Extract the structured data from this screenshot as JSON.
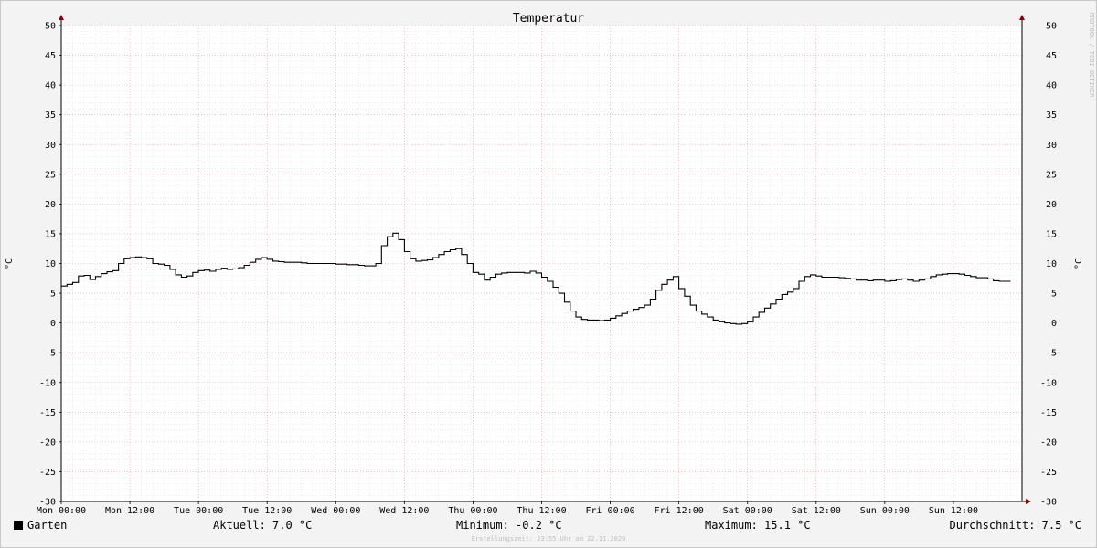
{
  "chart_data": {
    "type": "line",
    "title": "Temperatur",
    "ylabel_left": "°C",
    "ylabel_right": "°C",
    "ylim": [
      -30,
      50
    ],
    "y_ticks": [
      50,
      45,
      40,
      35,
      30,
      25,
      20,
      15,
      10,
      5,
      0,
      -5,
      -10,
      -15,
      -20,
      -25,
      -30
    ],
    "x_tick_labels": [
      "Mon 00:00",
      "Mon 12:00",
      "Tue 00:00",
      "Tue 12:00",
      "Wed 00:00",
      "Wed 12:00",
      "Thu 00:00",
      "Thu 12:00",
      "Fri 00:00",
      "Fri 12:00",
      "Sat 00:00",
      "Sat 12:00",
      "Sun 00:00",
      "Sun 12:00"
    ],
    "xlim_hours": [
      0,
      168
    ],
    "grid": true,
    "colors": {
      "background": "#f3f3f3",
      "plot": "#ffffff",
      "line": "#000000",
      "major_grid": "#e6a0a0",
      "minor_grid": "#dcdcdc",
      "arrow": "#8b0000"
    },
    "series": [
      {
        "name": "Garten",
        "x_hours": [
          0,
          1,
          2,
          3,
          4,
          5,
          6,
          7,
          8,
          9,
          10,
          11,
          12,
          13,
          14,
          15,
          16,
          17,
          18,
          19,
          20,
          21,
          22,
          23,
          24,
          25,
          26,
          27,
          28,
          29,
          30,
          31,
          32,
          33,
          34,
          35,
          36,
          37,
          38,
          39,
          40,
          41,
          42,
          43,
          44,
          45,
          46,
          47,
          48,
          49,
          50,
          51,
          52,
          53,
          54,
          55,
          56,
          57,
          58,
          59,
          60,
          61,
          62,
          63,
          64,
          65,
          66,
          67,
          68,
          69,
          70,
          71,
          72,
          73,
          74,
          75,
          76,
          77,
          78,
          79,
          80,
          81,
          82,
          83,
          84,
          85,
          86,
          87,
          88,
          89,
          90,
          91,
          92,
          93,
          94,
          95,
          96,
          97,
          98,
          99,
          100,
          101,
          102,
          103,
          104,
          105,
          106,
          107,
          108,
          109,
          110,
          111,
          112,
          113,
          114,
          115,
          116,
          117,
          118,
          119,
          120,
          121,
          122,
          123,
          124,
          125,
          126,
          127,
          128,
          129,
          130,
          131,
          132,
          133,
          134,
          135,
          136,
          137,
          138,
          139,
          140,
          141,
          142,
          143,
          144,
          145,
          146,
          147,
          148,
          149,
          150,
          151,
          152,
          153,
          154,
          155,
          156,
          157,
          158,
          159,
          160,
          161,
          162,
          163,
          164,
          165,
          166,
          167
        ],
        "values": [
          6.2,
          6.5,
          6.8,
          7.9,
          8.0,
          7.3,
          7.8,
          8.3,
          8.6,
          8.8,
          10.0,
          10.8,
          11.0,
          11.1,
          11.0,
          10.8,
          10.0,
          9.9,
          9.7,
          9.0,
          8.1,
          7.7,
          7.9,
          8.5,
          8.8,
          8.9,
          8.7,
          9.0,
          9.2,
          9.0,
          9.1,
          9.3,
          9.7,
          10.2,
          10.7,
          11.0,
          10.7,
          10.4,
          10.3,
          10.2,
          10.2,
          10.2,
          10.1,
          10.0,
          10.0,
          10.0,
          10.0,
          10.0,
          9.9,
          9.9,
          9.8,
          9.8,
          9.7,
          9.6,
          9.6,
          10.0,
          13.0,
          14.5,
          15.1,
          14.0,
          12.0,
          10.8,
          10.4,
          10.5,
          10.6,
          11.0,
          11.5,
          12.0,
          12.3,
          12.5,
          11.5,
          10.0,
          8.5,
          8.2,
          7.2,
          7.7,
          8.2,
          8.4,
          8.5,
          8.5,
          8.5,
          8.4,
          8.7,
          8.4,
          7.7,
          7.0,
          6.0,
          5.0,
          3.5,
          2.0,
          1.0,
          0.6,
          0.5,
          0.5,
          0.4,
          0.5,
          0.8,
          1.2,
          1.6,
          2.0,
          2.3,
          2.6,
          3.0,
          4.0,
          5.5,
          6.5,
          7.2,
          7.8,
          5.8,
          4.5,
          3.0,
          2.0,
          1.5,
          1.0,
          0.5,
          0.2,
          0.0,
          -0.1,
          -0.2,
          -0.1,
          0.2,
          1.0,
          1.8,
          2.5,
          3.2,
          4.0,
          4.8,
          5.2,
          5.8,
          7.0,
          7.8,
          8.1,
          7.9,
          7.7,
          7.7,
          7.7,
          7.6,
          7.5,
          7.4,
          7.2,
          7.2,
          7.1,
          7.2,
          7.2,
          7.0,
          7.1,
          7.3,
          7.4,
          7.2,
          7.0,
          7.2,
          7.4,
          7.8,
          8.1,
          8.2,
          8.3,
          8.3,
          8.2,
          8.0,
          7.8,
          7.6,
          7.6,
          7.4,
          7.1,
          7.0,
          7.0
        ]
      }
    ]
  },
  "legend": {
    "series_name": "Garten",
    "aktuell": "Aktuell: 7.0 °C",
    "minimum": "Minimum: -0.2 °C",
    "maximum": "Maximum: 15.1 °C",
    "durchschnitt": "Durchschnitt: 7.5 °C"
  },
  "footer": "Erstellungszeit: 23:55 Uhr am 22.11.2020",
  "watermark": "RRDTOOL / TOBI OETIKER"
}
